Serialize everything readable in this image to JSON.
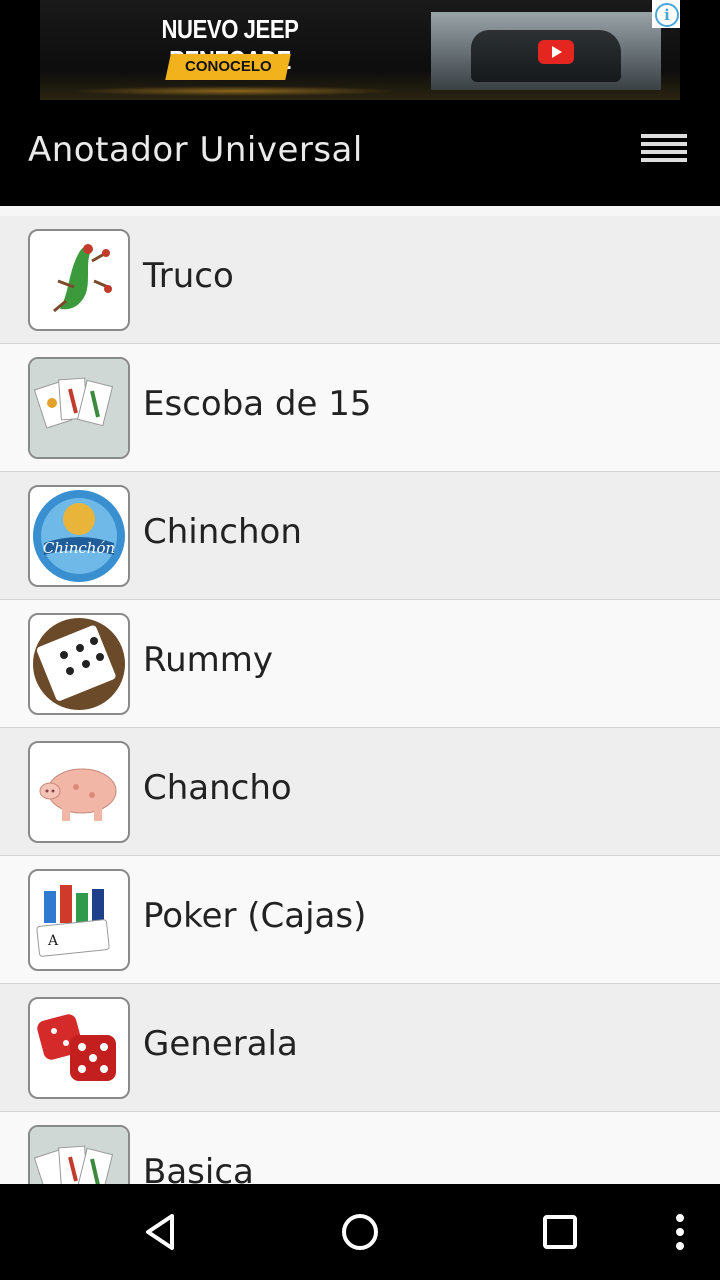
{
  "ad": {
    "headline": "NUEVO JEEP RENEGADE",
    "cta": "CONOCELO"
  },
  "header": {
    "title": "Anotador Universal"
  },
  "games": [
    {
      "label": "Truco",
      "icon": "lizard-card-icon"
    },
    {
      "label": "Escoba de 15",
      "icon": "spanish-cards-icon"
    },
    {
      "label": "Chinchon",
      "icon": "chinchon-badge-icon"
    },
    {
      "label": "Rummy",
      "icon": "rummy-tile-icon"
    },
    {
      "label": "Chancho",
      "icon": "pig-icon"
    },
    {
      "label": "Poker (Cajas)",
      "icon": "poker-chips-icon"
    },
    {
      "label": "Generala",
      "icon": "dice-icon"
    },
    {
      "label": "Basica",
      "icon": "spanish-cards-icon"
    }
  ],
  "colors": {
    "header_bg": "#000000",
    "row_alt": "#eeeeee",
    "row": "#f9f9f9",
    "ad_cta": "#f2b21c"
  }
}
